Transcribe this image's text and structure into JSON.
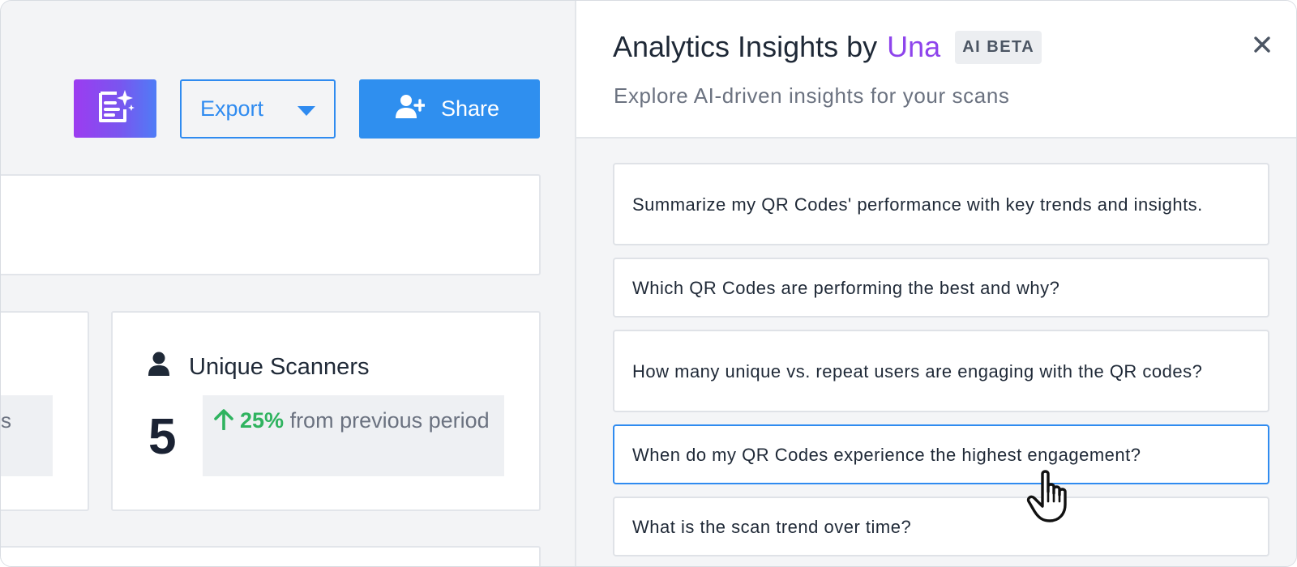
{
  "toolbar": {
    "ai_button_icon": "ai-document-sparkle-icon",
    "export_label": "Export",
    "share_label": "Share",
    "share_icon": "add-user-icon"
  },
  "metrics": {
    "partial_card_text": "s",
    "unique_scanners": {
      "icon": "person-icon",
      "label": "Unique Scanners",
      "value": "5",
      "change_pct": "25%",
      "change_text": "from previous period",
      "change_direction": "up"
    }
  },
  "insights_panel": {
    "title_prefix": "Analytics Insights by",
    "title_brand": "Una",
    "badge": "AI BETA",
    "subtitle": "Explore AI-driven insights for your scans",
    "prompts": [
      "Summarize my QR Codes' performance with key trends and insights.",
      "Which QR Codes are performing the best and why?",
      "How many unique vs. repeat users are engaging with the QR codes?",
      "When do my QR Codes experience the highest engagement?",
      "What is the scan trend over time?"
    ],
    "active_prompt_index": 3
  },
  "colors": {
    "accent_blue": "#2f8bf0",
    "brand_purple": "#8e44ec",
    "positive_green": "#2fb35f"
  }
}
